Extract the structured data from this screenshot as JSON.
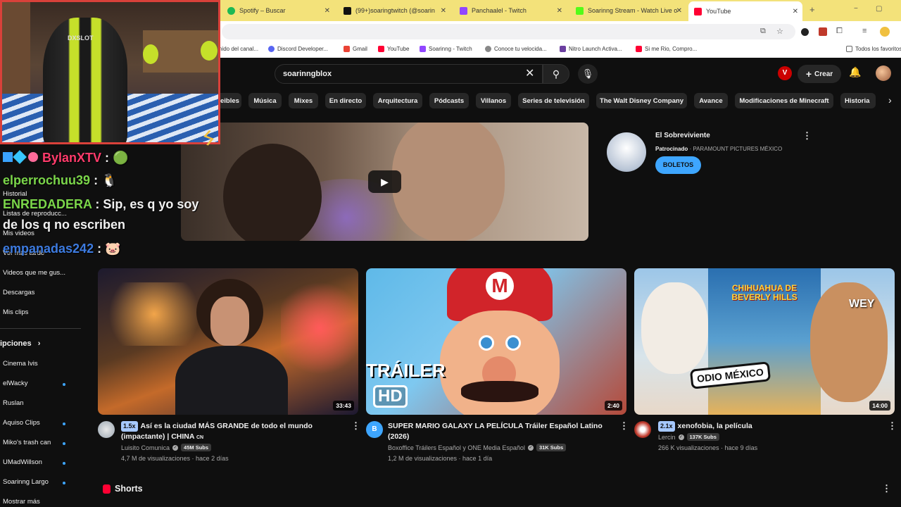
{
  "browser": {
    "tabs": [
      {
        "label": "Spotify – Buscar",
        "color": "#1db954"
      },
      {
        "label": "(99+)soaringtwitch (@soarin",
        "color": "#111111"
      },
      {
        "label": "Panchaalel - Twitch",
        "color": "#9146ff"
      },
      {
        "label": "Soarinng Stream - Watch Live o",
        "color": "#53fc18"
      },
      {
        "label": "YouTube",
        "color": "#ff0033"
      }
    ],
    "close_glyph": "✕",
    "new_tab_glyph": "+",
    "window_minimize": "−",
    "window_restore": "▢",
    "bookmarks": [
      {
        "label": "nido del canal...",
        "color": "#777777"
      },
      {
        "label": "Discord Developer...",
        "color": "#5865f2"
      },
      {
        "label": "Gmail",
        "color": "#ea4335"
      },
      {
        "label": "YouTube",
        "color": "#ff0033"
      },
      {
        "label": "Soarinng - Twitch",
        "color": "#9146ff"
      },
      {
        "label": "Conoce tu velocida...",
        "color": "#888888"
      },
      {
        "label": "Nitro Launch Activa...",
        "color": "#6b3fa0"
      },
      {
        "label": "Si me Rio, Compro...",
        "color": "#ff0033"
      }
    ],
    "all_favorites": "Todos los favoritos"
  },
  "header": {
    "search_value": "soarinngblox",
    "clear_glyph": "✕",
    "search_glyph": "⚲",
    "mic_glyph": "🎙",
    "badge": "V",
    "create_plus": "+",
    "create_label": "Crear",
    "bell_glyph": "🔔"
  },
  "chips": [
    "eibles",
    "Música",
    "Mixes",
    "En directo",
    "Arquitectura",
    "Pódcasts",
    "Villanos",
    "Series de televisión",
    "The Walt Disney Company",
    "Avance",
    "Modificaciones de Minecraft",
    "Historia"
  ],
  "chip_next": "›",
  "ad": {
    "play_glyph": "▶",
    "title": "El Sobreviviente",
    "sponsored": "Patrocinado",
    "advertiser": " · PARAMOUNT PICTURES MÉXICO",
    "button": "BOLETOS",
    "menu_glyph": "⋮"
  },
  "sidebar": {
    "items": [
      "Historial",
      "Listas de reproducc...",
      "Mis videos",
      "Ver más tarde",
      "Videos que me gus...",
      "Descargas",
      "Mis clips"
    ],
    "subs_title": "ipciones",
    "subs_chevron": "›",
    "subs": [
      "Cinema Ivis",
      "elWacky",
      "Ruslan",
      "Aquiso Clips",
      "Miko's trash can",
      "UMadWillson",
      "Soarinng Largo"
    ],
    "show_more": "Mostrar más"
  },
  "videos": [
    {
      "speed": "1.5x",
      "title": "Así es la ciudad MÁS GRANDE de todo el mundo (impactante) | CHINA",
      "flag": "CN",
      "channel": "Luisito Comunica",
      "subs": "45M Subs",
      "meta": "4,7 M de visualizaciones · hace 2 días",
      "duration": "33:43",
      "verified": "✓"
    },
    {
      "speed": "",
      "title": "SUPER MARIO GALAXY LA PELÍCULA Tráiler Español Latino (2026)",
      "flag": "",
      "channel": "Boxoffice Tráilers Español y ONE Media Español",
      "subs": "31K Subs",
      "meta": "1,2 M de visualizaciones · hace 1 día",
      "duration": "2:40",
      "overlay1": "TRÁILER",
      "overlay2": "HD",
      "avatar_letter": "B",
      "verified": "✓"
    },
    {
      "speed": "2.1x",
      "title": "xenofobia, la película",
      "flag": "",
      "channel": "Lercin",
      "subs": "137K Subs",
      "meta": "266 K visualizaciones · hace 9 días",
      "duration": "14:00",
      "overlay1": "ODIO MÉXICO",
      "overlay2": "WEY",
      "poster": "CHIHUAHUA DE BEVERLY HILLS",
      "verified": "✓"
    }
  ],
  "shorts": {
    "label": "Shorts"
  },
  "overlay": {
    "chat": [
      {
        "user": "BylanXTV",
        "sep": ":",
        "msg": "",
        "emote": "🟢",
        "color": "#ff3b6b"
      },
      {
        "user": "elperrochuu39",
        "sep": ":",
        "msg": "",
        "emote": "🐧",
        "color": "#7bd64a"
      },
      {
        "user": "ENREDADERA",
        "sep": ":",
        "msg": "Sip, es q yo soy",
        "emote": "",
        "color": "#7bd64a"
      },
      {
        "user": "",
        "sep": "",
        "msg": "de los q no escriben",
        "emote": "",
        "color": "#ffffff"
      },
      {
        "user": "empanadas242",
        "sep": ":",
        "msg": "",
        "emote": "🐷",
        "color": "#3d7be0"
      }
    ],
    "chair_brand": "DXSLOT",
    "bolt": "ϟ"
  }
}
